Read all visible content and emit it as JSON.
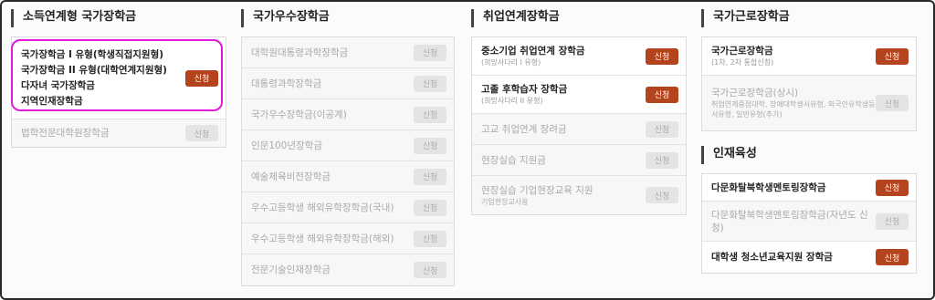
{
  "colors": {
    "accent": "#b4441e",
    "highlight": "#e21ad9"
  },
  "income": {
    "title": "소득연계형 국가장학금",
    "group_lines": [
      "국가장학금 I 유형(학생직접지원형)",
      "국가장학금 II 유형(대학연계지원형)",
      "다자녀 국가장학금",
      "지역인재장학금"
    ],
    "group_button": "신청",
    "law_item": "법학전문대학원장학금",
    "law_button": "신청"
  },
  "excellence": {
    "title": "국가우수장학금",
    "items": [
      {
        "label": "대학원대통령과학장학금",
        "button": "신청"
      },
      {
        "label": "대통령과학장학금",
        "button": "신청"
      },
      {
        "label": "국가우수장학금(이공계)",
        "button": "신청"
      },
      {
        "label": "인문100년장학금",
        "button": "신청"
      },
      {
        "label": "예술체육비전장학금",
        "button": "신청"
      },
      {
        "label": "우수고등학생 해외유학장학금(국내)",
        "button": "신청"
      },
      {
        "label": "우수고등학생 해외유학장학금(해외)",
        "button": "신청"
      },
      {
        "label": "전문기술인재장학금",
        "button": "신청"
      }
    ]
  },
  "employment": {
    "title": "취업연계장학금",
    "items": [
      {
        "label": "중소기업 취업연계 장학금",
        "sub": "(희망사다리 I 유형)",
        "button": "신청"
      },
      {
        "label": "고졸 후학습자 장학금",
        "sub": "(희망사다리 II 유형)",
        "button": "신청"
      },
      {
        "label": "고교 취업연계 장려금",
        "sub": "",
        "button": "신청"
      },
      {
        "label": "현장실습 지원금",
        "sub": "",
        "button": "신청"
      },
      {
        "label": "현장실습 기업현장교육 지원",
        "sub": "기업현장교사용",
        "button": "신청"
      }
    ]
  },
  "work": {
    "title": "국가근로장학금",
    "items": [
      {
        "label": "국가근로장학금",
        "sub": "(1차, 2차 통합신청)",
        "button": "신청"
      },
      {
        "label": "국가근로장학금(상시)",
        "sub": "취업연계중점대학, 장애대학생서유형, 외국인유학생등서유형, 일반유형(추가)",
        "button": "신청"
      }
    ]
  },
  "talent": {
    "title": "인재육성",
    "items": [
      {
        "label": "다문화탈북학생멘토링장학금",
        "button": "신청"
      },
      {
        "label": "다문화탈북학생멘토링장학금(자년도 신청)",
        "button": "신청"
      },
      {
        "label": "대학생 청소년교육지원 장학금",
        "button": "신청"
      }
    ]
  }
}
